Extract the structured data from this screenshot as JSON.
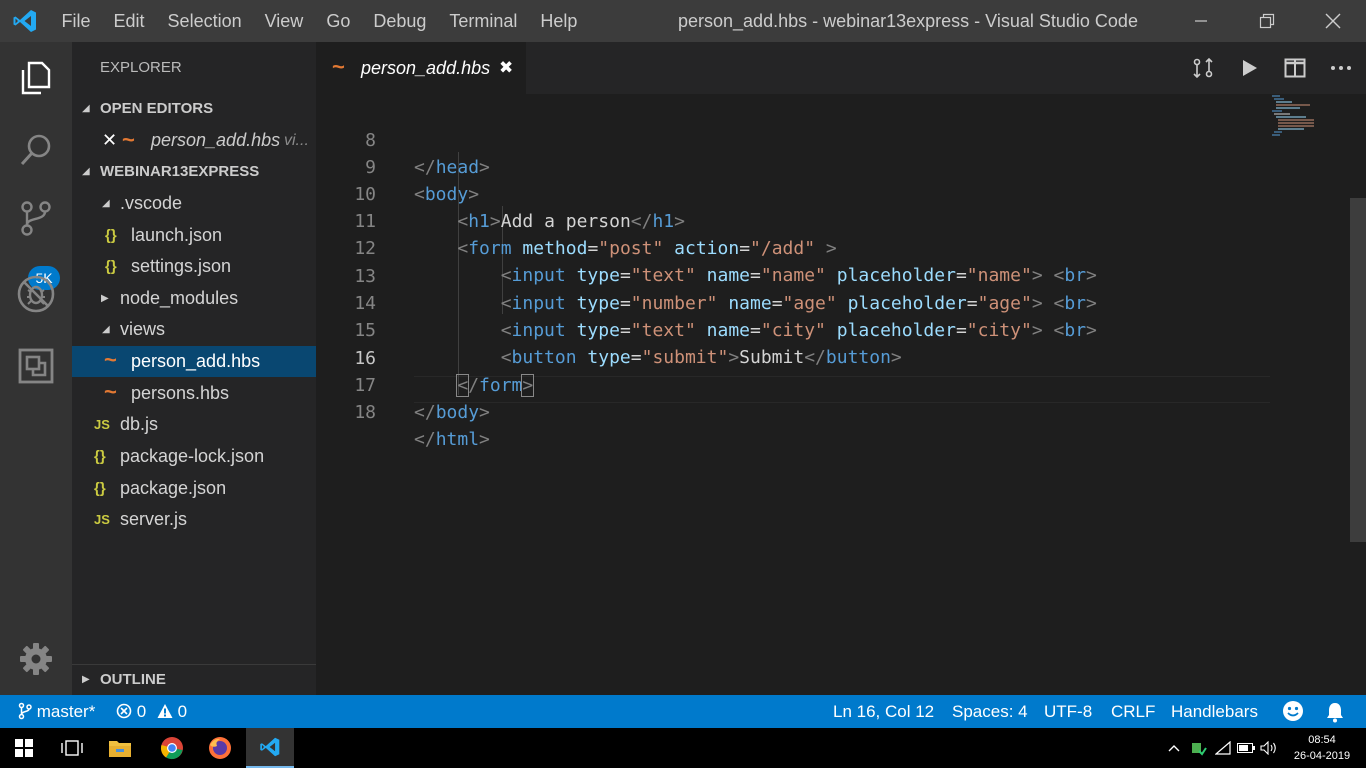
{
  "titlebar": {
    "menu": [
      "File",
      "Edit",
      "Selection",
      "View",
      "Go",
      "Debug",
      "Terminal",
      "Help"
    ],
    "title": "person_add.hbs - webinar13express - Visual Studio Code"
  },
  "activity_bar": {
    "icons": [
      "explorer-icon",
      "search-icon",
      "source-control-icon",
      "debug-icon",
      "extensions-icon",
      "settings-gear-icon"
    ],
    "source_control_badge": "5K"
  },
  "sidebar": {
    "title": "EXPLORER",
    "open_editors_header": "OPEN EDITORS",
    "open_editor": {
      "name": "person_add.hbs",
      "folder": "vi..."
    },
    "project_header": "WEBINAR13EXPRESS",
    "tree": [
      {
        "label": ".vscode",
        "type": "folder-open"
      },
      {
        "label": "launch.json",
        "type": "json"
      },
      {
        "label": "settings.json",
        "type": "json"
      },
      {
        "label": "node_modules",
        "type": "folder-closed"
      },
      {
        "label": "views",
        "type": "folder-open"
      },
      {
        "label": "person_add.hbs",
        "type": "hbs",
        "selected": true
      },
      {
        "label": "persons.hbs",
        "type": "hbs"
      },
      {
        "label": "db.js",
        "type": "js"
      },
      {
        "label": "package-lock.json",
        "type": "json"
      },
      {
        "label": "package.json",
        "type": "json"
      },
      {
        "label": "server.js",
        "type": "js"
      }
    ],
    "outline_header": "OUTLINE"
  },
  "editor": {
    "tab_label": "person_add.hbs",
    "current_line": 16,
    "lines": [
      {
        "no": "8",
        "text": "</head>"
      },
      {
        "no": "9",
        "text": "<body>"
      },
      {
        "no": "10",
        "text": "    <h1>Add a person</h1>"
      },
      {
        "no": "11",
        "text": "    <form method=\"post\" action=\"/add\" >"
      },
      {
        "no": "12",
        "text": "        <input type=\"text\" name=\"name\" placeholder=\"name\"> <br>"
      },
      {
        "no": "13",
        "text": "        <input type=\"number\" name=\"age\" placeholder=\"age\"> <br>"
      },
      {
        "no": "14",
        "text": "        <input type=\"text\" name=\"city\" placeholder=\"city\"> <br>"
      },
      {
        "no": "15",
        "text": "        <button type=\"submit\">Submit</button>"
      },
      {
        "no": "16",
        "text": "    </form>"
      },
      {
        "no": "17",
        "text": "</body>"
      },
      {
        "no": "18",
        "text": "</html>"
      }
    ]
  },
  "statusbar": {
    "branch": "master*",
    "errors": "0",
    "warnings": "0",
    "position": "Ln 16, Col 12",
    "spaces": "Spaces: 4",
    "encoding": "UTF-8",
    "eol": "CRLF",
    "language": "Handlebars"
  },
  "taskbar": {
    "apps": [
      "windows-start-icon",
      "task-view-icon",
      "file-explorer-icon",
      "chrome-icon",
      "firefox-icon",
      "vscode-icon"
    ],
    "time": "08:54",
    "date": "26-04-2019"
  },
  "colors": {
    "accent": "#007acc",
    "selection": "#094771",
    "tag": "#569cd6",
    "attribute": "#9cdcfe",
    "string": "#ce9178",
    "hbs_icon": "#e37933",
    "json_icon": "#cbcb41"
  }
}
